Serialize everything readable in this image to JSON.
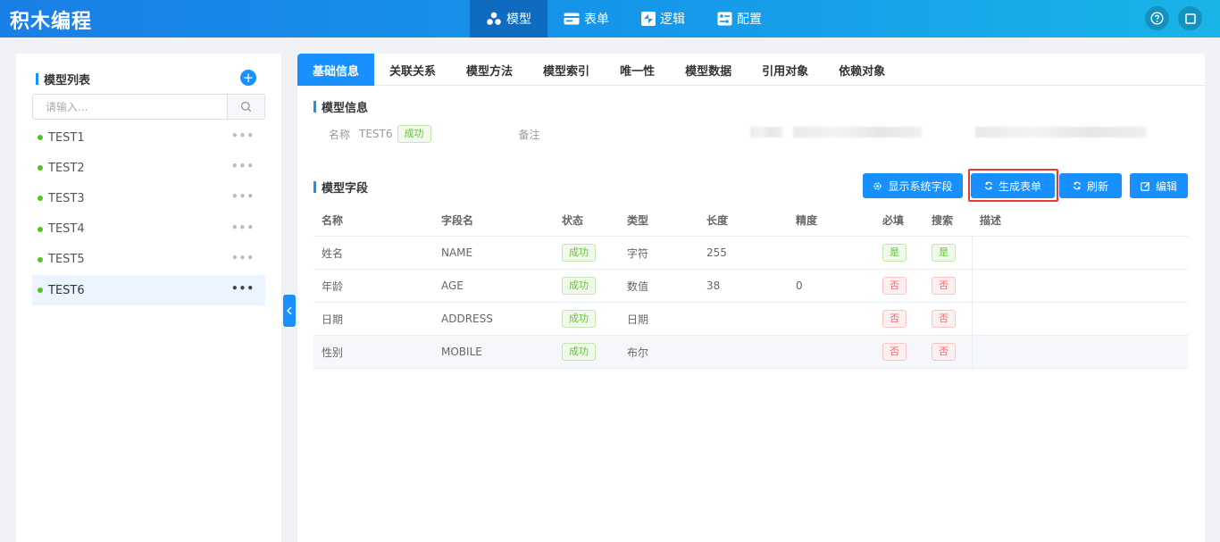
{
  "app": {
    "title": "积木编程"
  },
  "topnav": [
    {
      "label": "模型",
      "icon": "model-icon",
      "active": true
    },
    {
      "label": "表单",
      "icon": "form-icon",
      "active": false
    },
    {
      "label": "逻辑",
      "icon": "logic-icon",
      "active": false
    },
    {
      "label": "配置",
      "icon": "config-icon",
      "active": false
    }
  ],
  "left": {
    "heading": "模型列表",
    "add_label": "+",
    "search_placeholder": "请输入...",
    "items": [
      {
        "name": "TEST1",
        "more": "•••"
      },
      {
        "name": "TEST2",
        "more": "•••"
      },
      {
        "name": "TEST3",
        "more": "•••"
      },
      {
        "name": "TEST4",
        "more": "•••"
      },
      {
        "name": "TEST5",
        "more": "•••"
      },
      {
        "name": "TEST6",
        "more": "•••"
      }
    ]
  },
  "tabs": [
    "基础信息",
    "关联关系",
    "模型方法",
    "模型索引",
    "唯一性",
    "模型数据",
    "引用对象",
    "依赖对象"
  ],
  "model_info": {
    "title": "模型信息",
    "name_label": "名称",
    "name_value": "TEST6",
    "status": "成功",
    "remark_label": "备注"
  },
  "fields": {
    "title": "模型字段",
    "buttons": {
      "show_system": "显示系统字段",
      "generate_form": "生成表单",
      "refresh": "刷新",
      "edit": "编辑"
    },
    "columns": [
      "名称",
      "字段名",
      "状态",
      "类型",
      "长度",
      "精度",
      "必填",
      "搜索",
      "描述"
    ],
    "rows": [
      {
        "name": "姓名",
        "field": "NAME",
        "status": "成功",
        "type": "字符",
        "length": "255",
        "precision": "",
        "required": "是",
        "search": "是"
      },
      {
        "name": "年龄",
        "field": "AGE",
        "status": "成功",
        "type": "数值",
        "length": "38",
        "precision": "0",
        "required": "否",
        "search": "否"
      },
      {
        "name": "日期",
        "field": "ADDRESS",
        "status": "成功",
        "type": "日期",
        "length": "",
        "precision": "",
        "required": "否",
        "search": "否"
      },
      {
        "name": "性别",
        "field": "MOBILE",
        "status": "成功",
        "type": "布尔",
        "length": "",
        "precision": "",
        "required": "否",
        "search": "否"
      }
    ]
  },
  "colors": {
    "primary": "#1890ff",
    "success": "#67c23a",
    "danger": "#f56c6c",
    "highlight": "#e53935"
  }
}
